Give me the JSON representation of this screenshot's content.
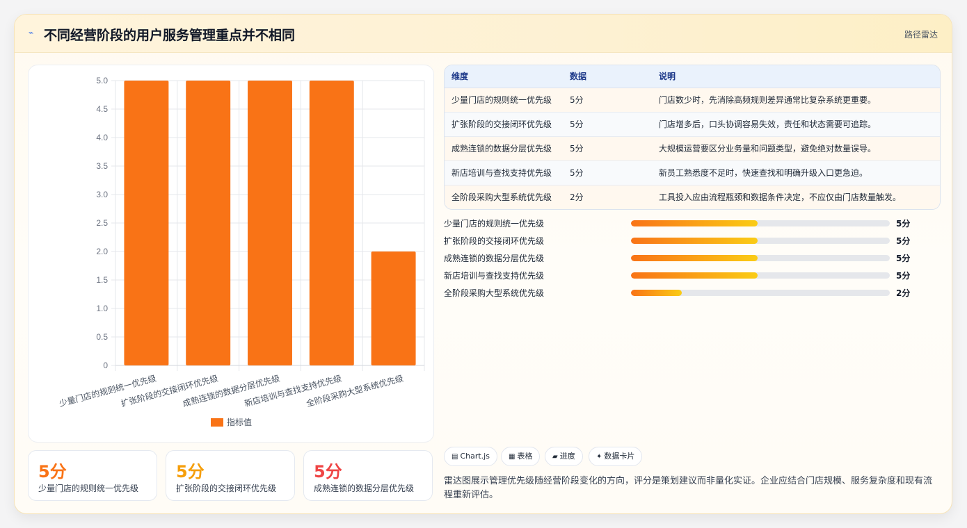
{
  "header": {
    "title": "不同经营阶段的用户服务管理重点并不相同",
    "tag": "路径雷达",
    "logo_icon": "sparkle-icon"
  },
  "chart_data": {
    "type": "bar",
    "categories": [
      "少量门店的规则统一优先级",
      "扩张阶段的交接闭环优先级",
      "成熟连锁的数据分层优先级",
      "新店培训与查找支持优先级",
      "全阶段采购大型系统优先级"
    ],
    "series": [
      {
        "name": "指标值",
        "values": [
          5,
          5,
          5,
          5,
          2
        ],
        "color": "#f97316"
      }
    ],
    "ylim": [
      0,
      5
    ],
    "yticks": [
      "0",
      "0.5",
      "1.0",
      "1.5",
      "2.0",
      "2.5",
      "3.0",
      "3.5",
      "4.0",
      "4.5",
      "5.0"
    ],
    "grid": true,
    "legend": "bottom"
  },
  "kpis": [
    {
      "value": "5分",
      "label": "少量门店的规则统一优先级",
      "color": "#f97316"
    },
    {
      "value": "5分",
      "label": "扩张阶段的交接闭环优先级",
      "color": "#f59e0b"
    },
    {
      "value": "5分",
      "label": "成熟连锁的数据分层优先级",
      "color": "#ef4444"
    }
  ],
  "table": {
    "headers": [
      "维度",
      "数据",
      "说明"
    ],
    "rows": [
      [
        "少量门店的规则统一优先级",
        "5分",
        "门店数少时，先消除高频规则差异通常比复杂系统更重要。"
      ],
      [
        "扩张阶段的交接闭环优先级",
        "5分",
        "门店增多后，口头协调容易失效，责任和状态需要可追踪。"
      ],
      [
        "成熟连锁的数据分层优先级",
        "5分",
        "大规模运营要区分业务量和问题类型，避免绝对数量误导。"
      ],
      [
        "新店培训与查找支持优先级",
        "5分",
        "新员工熟悉度不足时，快速查找和明确升级入口更急迫。"
      ],
      [
        "全阶段采购大型系统优先级",
        "2分",
        "工具投入应由流程瓶颈和数据条件决定，不应仅由门店数量触发。"
      ]
    ]
  },
  "progress": [
    {
      "label": "少量门店的规则统一优先级",
      "value": "5分",
      "fraction": 0.49
    },
    {
      "label": "扩张阶段的交接闭环优先级",
      "value": "5分",
      "fraction": 0.49
    },
    {
      "label": "成熟连锁的数据分层优先级",
      "value": "5分",
      "fraction": 0.49
    },
    {
      "label": "新店培训与查找支持优先级",
      "value": "5分",
      "fraction": 0.49
    },
    {
      "label": "全阶段采购大型系统优先级",
      "value": "2分",
      "fraction": 0.196
    }
  ],
  "chips": [
    {
      "icon": "chart-icon",
      "glyph": "▤",
      "label": "Chart.js"
    },
    {
      "icon": "table-icon",
      "glyph": "▦",
      "label": "表格"
    },
    {
      "icon": "progress-icon",
      "glyph": "▰",
      "label": "进度"
    },
    {
      "icon": "card-icon",
      "glyph": "✦",
      "label": "数据卡片"
    }
  ],
  "note": "雷达图展示管理优先级随经营阶段变化的方向，评分是策划建议而非量化实证。企业应结合门店规模、服务复杂度和现有流程重新评估。"
}
